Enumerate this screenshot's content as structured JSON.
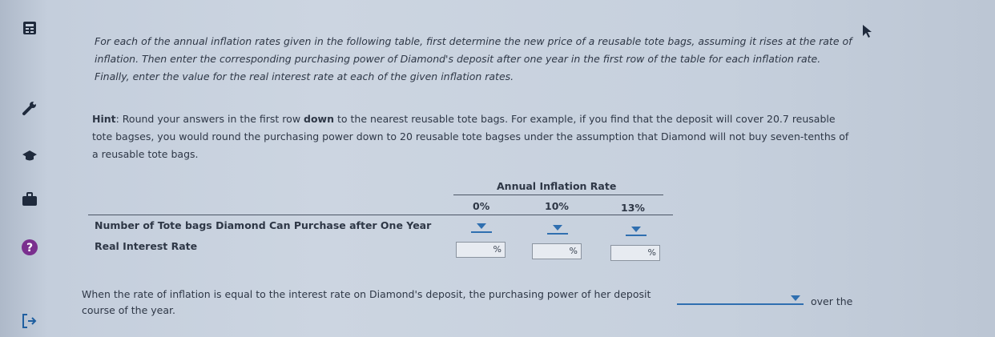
{
  "intro": {
    "line1": "For each of the annual inflation rates given in the following table, first determine the new price of a reusable tote bags, assuming it rises at the rate of",
    "line2": "inflation. Then enter the corresponding purchasing power of Diamond's deposit after one year in the first row of the table for each inflation rate.",
    "line3": "Finally, enter the value for the real interest rate at each of the given inflation rates."
  },
  "hint": {
    "label": "Hint",
    "part1": ": Round your answers in the first row ",
    "emph": "down",
    "part2": " to the nearest reusable tote bags. For example, if you find that the deposit will cover 20.7 reusable",
    "line2": "tote bagses, you would round the purchasing power down to 20 reusable tote bagses under the assumption that Diamond will not buy seven-tenths of",
    "line3": "a reusable tote bags."
  },
  "table": {
    "group_header": "Annual Inflation Rate",
    "columns": [
      "0%",
      "10%",
      "13%"
    ],
    "rows": [
      {
        "label": "Number of Tote bags Diamond Can Purchase after One Year",
        "input_type": "dropdown"
      },
      {
        "label": "Real Interest Rate",
        "input_type": "percent",
        "unit": "%"
      }
    ]
  },
  "final": {
    "line1": "When the rate of inflation is equal to the interest rate on Diamond's deposit, the purchasing power of her deposit",
    "after": "over the",
    "line2": "course of the year."
  },
  "sidebar": {
    "icons": [
      "calculator-icon",
      "wrench-icon",
      "graduation-cap-icon",
      "briefcase-icon",
      "help-icon",
      "exit-icon"
    ],
    "help_glyph": "?"
  },
  "colors": {
    "accent": "#2f6fb0",
    "text": "#2e3746",
    "help_circle": "#7a2f8e"
  }
}
